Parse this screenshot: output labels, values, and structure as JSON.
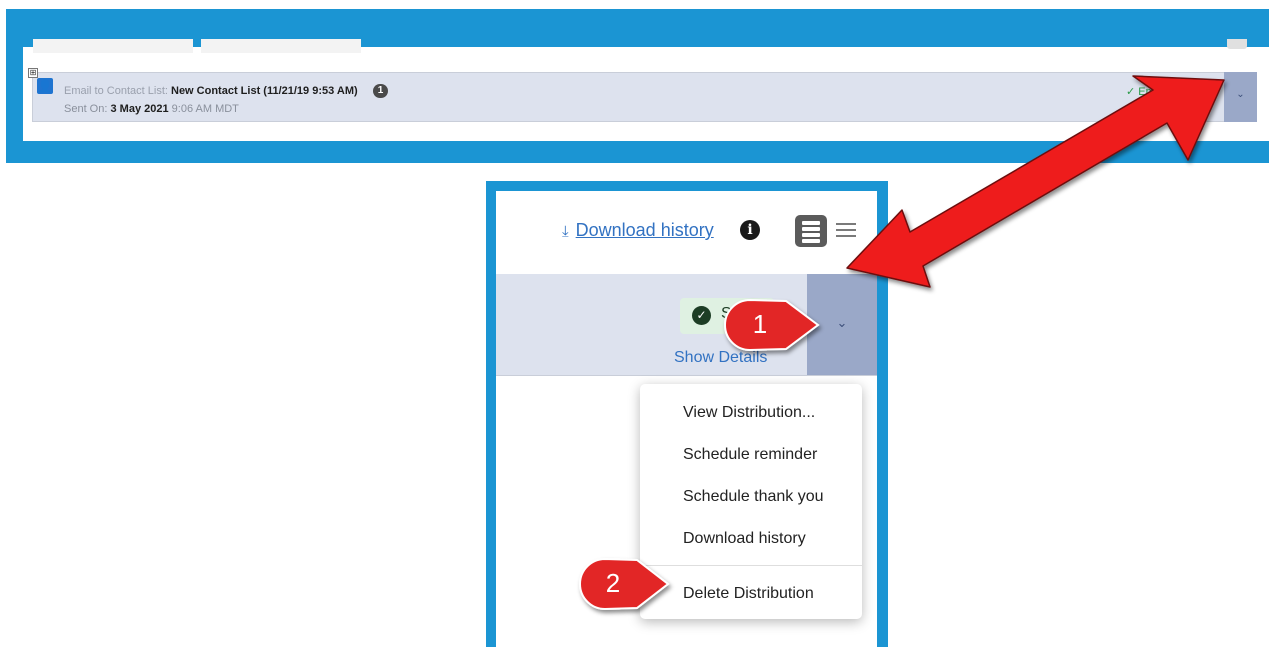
{
  "distribution_row": {
    "type_label": "Email to Contact List:",
    "list_name": "New Contact List (11/21/19 9:53 AM)",
    "count": "1",
    "sent_on_label": "Sent On:",
    "sent_on_date": "3 May 2021",
    "sent_on_time": "9:06 AM MDT",
    "status": "Email Sent",
    "expand_icon": "⊞",
    "contact_icon": "user-icon",
    "dropdown_icon": "chevron-down-icon"
  },
  "zoomed_view": {
    "download_history_link": "Download history",
    "download_icon": "download-icon",
    "info_icon": "info-icon",
    "status": "Sent",
    "show_details": "Show Details"
  },
  "menu": {
    "items": [
      {
        "label": "View Distribution..."
      },
      {
        "label": "Schedule reminder"
      },
      {
        "label": "Schedule thank you"
      },
      {
        "label": "Download history"
      },
      {
        "label": "Delete Distribution"
      }
    ]
  },
  "annotations": {
    "step1": "1",
    "step2": "2",
    "arrow_color": "#ee1c1c"
  },
  "colors": {
    "frame_blue": "#1b95d3",
    "row_bg": "#dde2ee",
    "dropdown_bg": "#9aa8c8",
    "link_blue": "#3272c2",
    "sent_green": "#2a9a48"
  }
}
